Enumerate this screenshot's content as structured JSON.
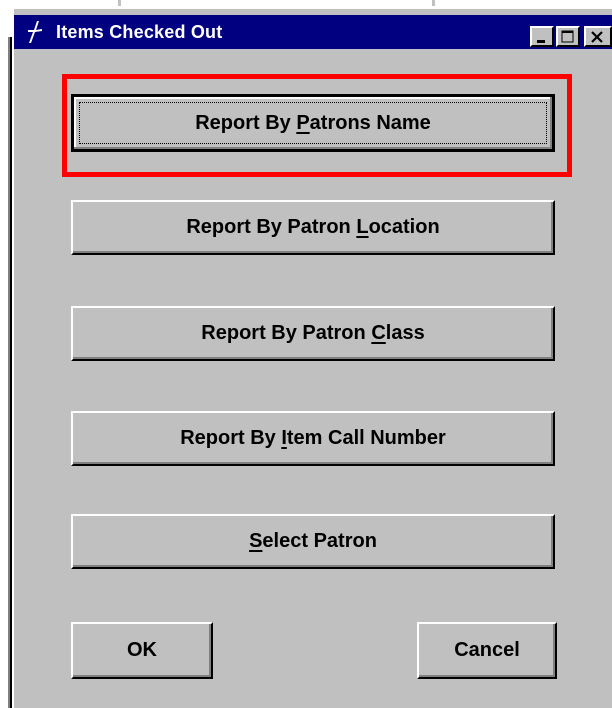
{
  "window": {
    "title": "Items Checked Out",
    "icon": "dagger-app-icon"
  },
  "titlebar_buttons": [
    "minimize-icon",
    "maximize-icon",
    "close-icon"
  ],
  "buttons": {
    "patrons_name": {
      "pre": "Report By ",
      "mnemonic": "P",
      "post": "atrons Name"
    },
    "patron_location": {
      "pre": "Report By Patron ",
      "mnemonic": "L",
      "post": "ocation"
    },
    "patron_class": {
      "pre": "Report By Patron ",
      "mnemonic": "C",
      "post": "lass"
    },
    "item_call_number": {
      "pre": "Report By ",
      "mnemonic": "I",
      "post": "tem Call Number"
    },
    "select_patron": {
      "pre": "",
      "mnemonic": "S",
      "post": "elect Patron"
    },
    "ok": "OK",
    "cancel": "Cancel"
  },
  "colors": {
    "title_bar": "#000080",
    "face": "#c0c0c0",
    "highlight_box": "#ff0000"
  }
}
